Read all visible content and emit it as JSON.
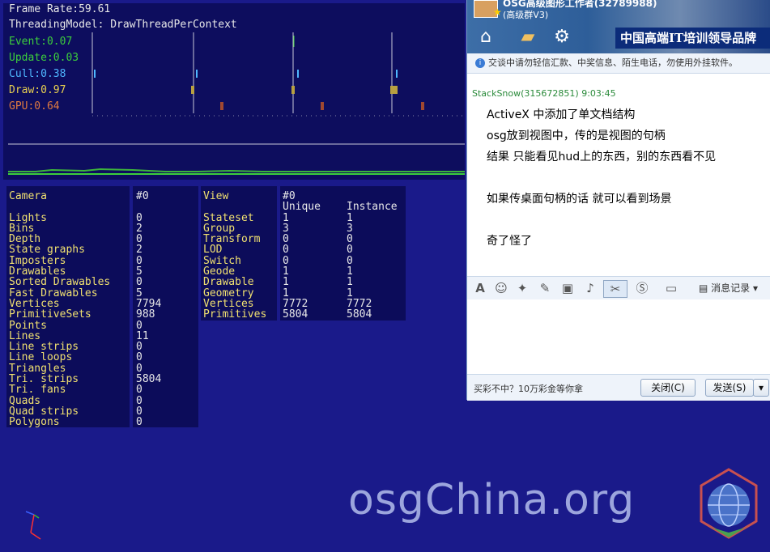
{
  "osg": {
    "frame_rate": "Frame Rate:59.61",
    "threading": "ThreadingModel: DrawThreadPerContext",
    "timers": [
      {
        "label": "Event:0.07",
        "color": "#3ccf3c"
      },
      {
        "label": "Update:0.03",
        "color": "#3ccf3c"
      },
      {
        "label": "Cull:0.38",
        "color": "#4fb8ff"
      },
      {
        "label": "Draw:0.97",
        "color": "#e8d050"
      },
      {
        "label": "GPU:0.64",
        "color": "#e07a40"
      }
    ],
    "camera_stats": {
      "labels": [
        "Camera",
        "",
        "Lights",
        "Bins",
        "Depth",
        "State graphs",
        "Imposters",
        "Drawables",
        "Sorted Drawables",
        "Fast Drawables",
        "Vertices",
        "PrimitiveSets",
        "Points",
        "Lines",
        "Line strips",
        "Line loops",
        "Triangles",
        "Tri. strips",
        "Tri. fans",
        "Quads",
        "Quad strips",
        "Polygons"
      ],
      "values": [
        "#0",
        "",
        "0",
        "2",
        "0",
        "2",
        "0",
        "5",
        "0",
        "5",
        "7794",
        "988",
        "0",
        "11",
        "0",
        "0",
        "0",
        "5804",
        "0",
        "0",
        "0",
        "0"
      ]
    },
    "view_stats": {
      "labels": [
        "View",
        "",
        "Stateset",
        "Group",
        "Transform",
        "LOD",
        "Switch",
        "Geode",
        "Drawable",
        "Geometry",
        "Vertices",
        "Primitives"
      ],
      "unique": [
        "#0",
        "Unique",
        "1",
        "3",
        "0",
        "0",
        "0",
        "1",
        "1",
        "1",
        "7772",
        "5804"
      ],
      "instance": [
        "",
        "Instance",
        "1",
        "3",
        "0",
        "0",
        "0",
        "1",
        "1",
        "1",
        "7772",
        "5804"
      ]
    },
    "watermark": "osgChina.org"
  },
  "chat": {
    "title": "OSG高级图形工作者(32789988)",
    "subtitle": "(高级群V3)",
    "banner": "中国高端IT培训领导品牌",
    "notice": "交谈中请勿轻信汇款、中奖信息、陌生电话，勿使用外挂软件。",
    "sender": "StackSnow(315672851)  9:03:45",
    "messages": [
      "ActiveX 中添加了单文档结构",
      "osg放到视图中，传的是视图的句柄",
      "结果 只能看见hud上的东西，别的东西看不见",
      "",
      "如果传桌面句柄的话 就可以看到场景",
      "",
      "奇了怪了"
    ],
    "history_label": "消息记录",
    "promo": "买彩不中？10万彩金等你拿",
    "close_label": "关闭(C)",
    "send_label": "发送(S)"
  },
  "icons": [
    "home-icon",
    "folder-icon",
    "gear-icon",
    "font-icon",
    "smiley-icon",
    "magic-icon",
    "edit-icon",
    "image-icon",
    "music-icon",
    "scissors-icon",
    "s-coin-icon",
    "screen-icon",
    "chevron-down-icon",
    "info-icon"
  ]
}
